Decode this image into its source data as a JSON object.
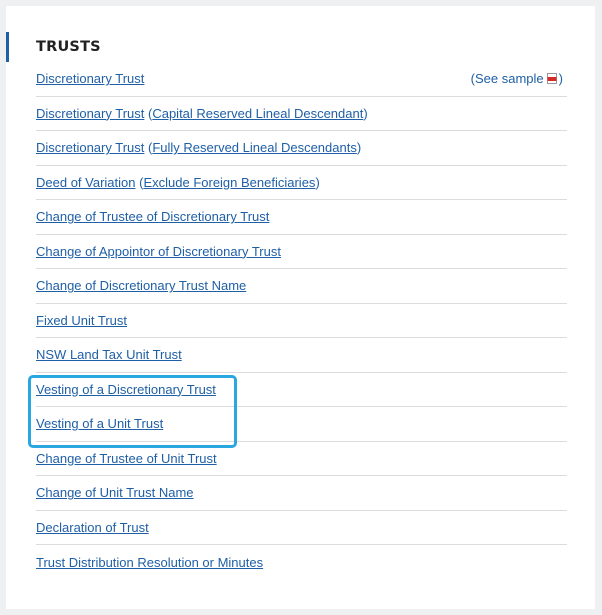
{
  "section": {
    "heading": "TRUSTS"
  },
  "items": [
    {
      "main": "Discretionary Trust",
      "suffix": "",
      "sample": {
        "open": "(",
        "label": "See sample",
        "close": ")"
      }
    },
    {
      "main": "Discretionary Trust",
      "open": " (",
      "sub": "Capital Reserved Lineal Descendant",
      "close": ")"
    },
    {
      "main": "Discretionary Trust",
      "open": " (",
      "sub": "Fully Reserved Lineal Descendants",
      "close": ")"
    },
    {
      "main": "Deed of Variation",
      "open": " (",
      "sub": "Exclude Foreign Beneficiaries",
      "close": ")"
    },
    {
      "main": "Change of Trustee of Discretionary Trust"
    },
    {
      "main": "Change of Appointor of Discretionary Trust"
    },
    {
      "main": "Change of Discretionary Trust Name"
    },
    {
      "main": "Fixed Unit Trust"
    },
    {
      "main": "NSW Land Tax Unit Trust"
    },
    {
      "main": "Vesting of a Discretionary Trust"
    },
    {
      "main": "Vesting of a Unit Trust"
    },
    {
      "main": "Change of Trustee of Unit Trust"
    },
    {
      "main": "Change of Unit Trust Name"
    },
    {
      "main": "Declaration of Trust"
    },
    {
      "main": "Trust Distribution Resolution or Minutes"
    }
  ],
  "icons": {
    "pdf": "pdf-icon"
  },
  "colors": {
    "link": "#1f5fa6",
    "accent_bar": "#1f5fa6",
    "highlight": "#2aa7e0"
  }
}
